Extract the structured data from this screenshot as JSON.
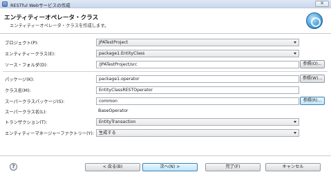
{
  "window": {
    "title": "RESTful Webサービスの作成",
    "close_glyph": "✕"
  },
  "header": {
    "title": "エンティティーオペレータ・クラス",
    "description": "エンティティーオペレータ・クラスを作成します。",
    "icon": "wizard-globe-icon"
  },
  "form": {
    "project_label": "プロジェクト(P):",
    "project_value": "JPATestProject",
    "entity_class_label": "エンティティークラス(E):",
    "entity_class_value": "package1.EntityClass",
    "source_folder_label": "ソース・フォルダ(D):",
    "source_folder_value": "/JPATestProject/src",
    "source_folder_browse": "参照(O)...",
    "package_label": "パッケージ(K):",
    "package_value": "package1.operator",
    "package_browse": "参照(W)...",
    "class_name_label": "クラス名(M):",
    "class_name_value": "EntityClassRESTOperator",
    "superclass_package_label": "スーパークラスパッケージ(S):",
    "superclass_package_value": "common",
    "superclass_package_browse": "参照(R)...",
    "superclass_name_label": "スーパークラス名(L):",
    "superclass_name_value": "BaseOperator",
    "transaction_label": "トランザクション(T):",
    "transaction_value": "EntityTransaction",
    "entity_manager_factory_label": "エンティティーマネージャーファクトリー(Y):",
    "entity_manager_factory_value": "生成する"
  },
  "footer": {
    "help_glyph": "?",
    "back_label": "< 戻る(B)",
    "next_label": "次へ(N) >",
    "finish_label": "完了(F)",
    "cancel_label": "キャンセル"
  }
}
